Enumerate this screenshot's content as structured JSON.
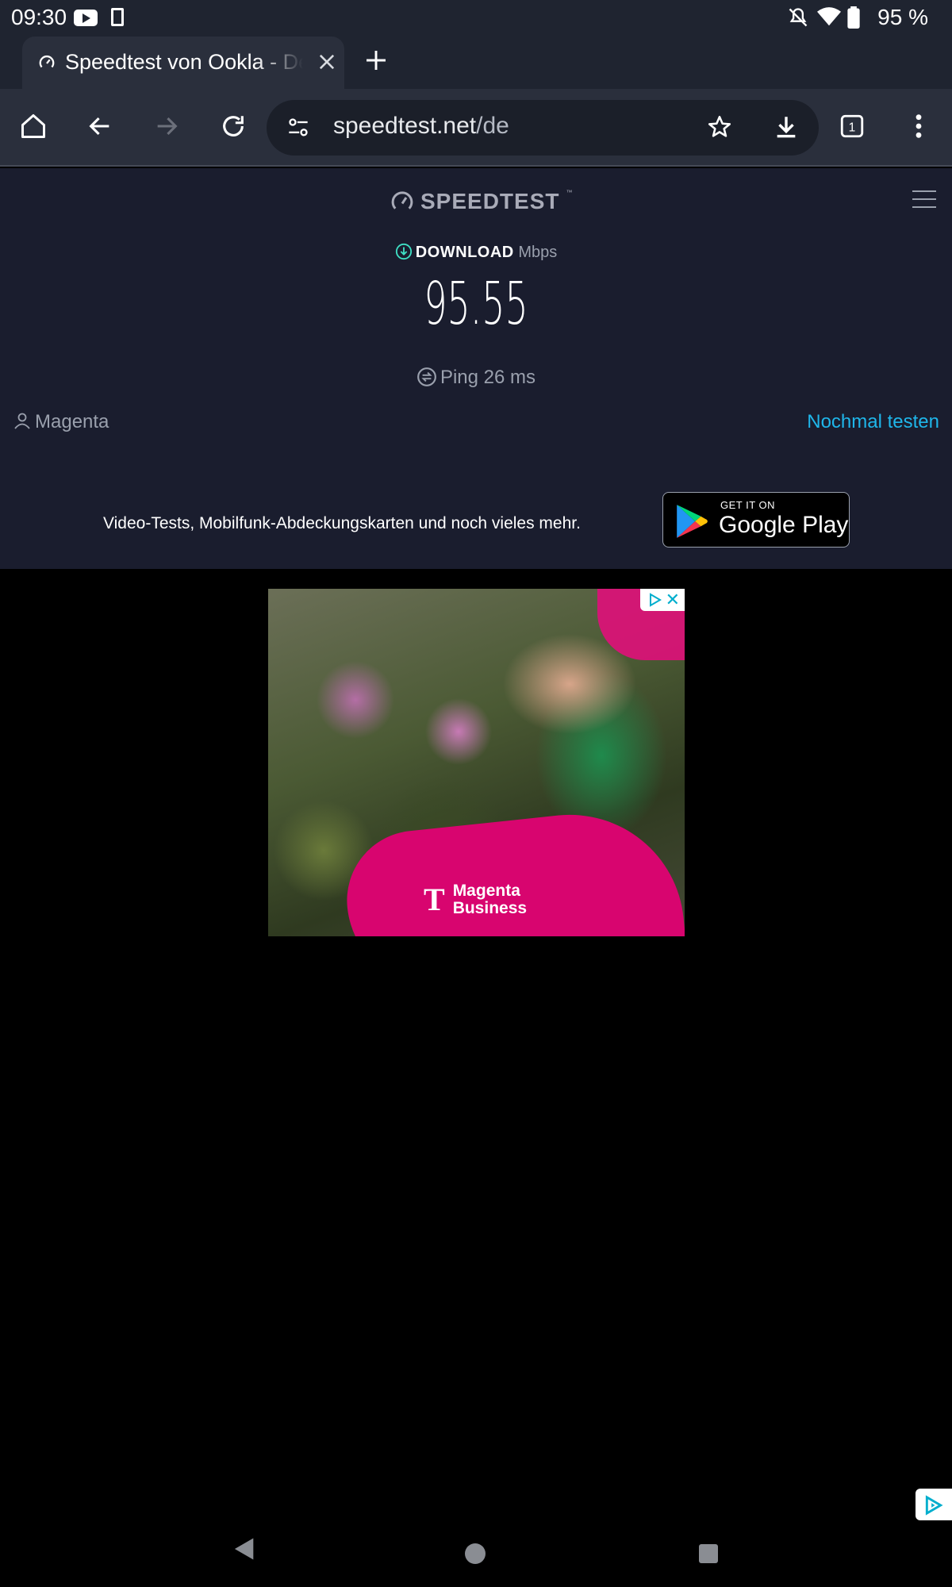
{
  "status_bar": {
    "time": "09:30",
    "battery": "95 %"
  },
  "tab": {
    "title": "Speedtest von Ookla - Der umfassende Test der Breitbandgeschwindigkeit"
  },
  "omnibox": {
    "host": "speedtest.net",
    "path": "/de"
  },
  "tabs_count": "1",
  "speedtest": {
    "logo": "SPEEDTEST",
    "download_label": "DOWNLOAD",
    "download_unit": "Mbps",
    "download_value": "95.55",
    "ping_text": "Ping 26 ms",
    "isp": "Magenta",
    "retest": "Nochmal testen",
    "promo": "Video-Tests, Mobilfunk-Abdeckungskarten und noch vieles mehr.",
    "gplay_small": "GET IT ON",
    "gplay_big": "Google Play"
  },
  "ad": {
    "brand_line1": "Magenta",
    "brand_line2": "Business",
    "brand_mark": "T"
  },
  "icons": [
    "youtube-icon",
    "sim-icon",
    "bell-off-icon",
    "wifi-icon",
    "battery-icon",
    "favicon-icon",
    "close-icon",
    "plus-icon",
    "home-icon",
    "back-icon",
    "forward-icon",
    "reload-icon",
    "tune-icon",
    "star-icon",
    "download-icon",
    "menu-dots-icon",
    "gauge-icon",
    "hamburger-icon",
    "download-arrow-icon",
    "ping-icon",
    "person-icon",
    "play-store-icon",
    "adchoices-icon"
  ],
  "colors": {
    "accent": "#1fb6ea",
    "page_bg": "#1a1d2e",
    "chrome_bg": "#2a2f3c",
    "ad_pink": "#d8056f"
  }
}
